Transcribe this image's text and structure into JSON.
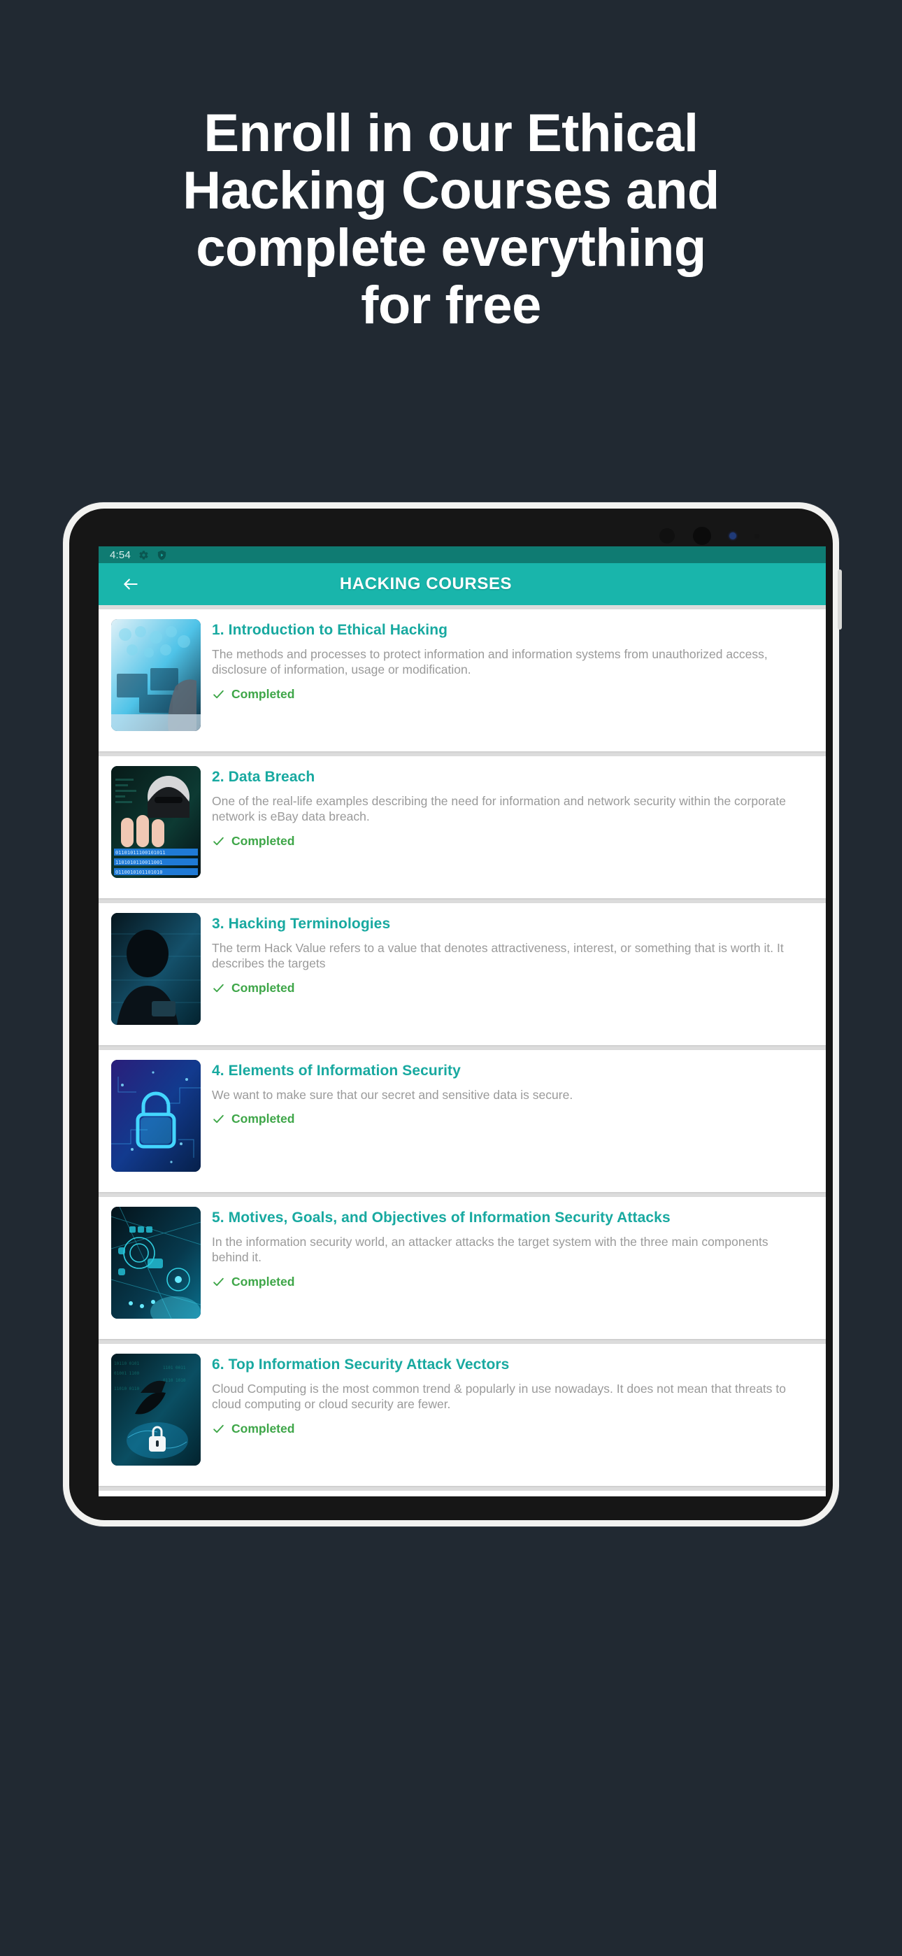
{
  "headline": {
    "lines": [
      "Enroll in our Ethical",
      "Hacking Courses and",
      "complete everything",
      "for free"
    ]
  },
  "colors": {
    "background": "#212932",
    "accent": "#19b5ab",
    "statusbar": "#0f7b72",
    "title_teal": "#18a9a0",
    "completed_green": "#3ea648",
    "desc_grey": "#9a9a9a",
    "list_bg": "#dcdcdc"
  },
  "device": {
    "status_bar": {
      "time": "4:54",
      "icons": [
        "gear-icon",
        "shield-play-icon"
      ]
    },
    "app_bar": {
      "back_icon": "back-arrow-icon",
      "title": "HACKING COURSES"
    }
  },
  "courses": [
    {
      "title": "1. Introduction to Ethical Hacking",
      "description": "The methods and processes to protect information and information systems from unauthorized access,\ndisclosure of information, usage or modification.",
      "status": "Completed",
      "status_icon": "check-icon",
      "thumbnail": "hacker-multiple-monitors-thumbnail"
    },
    {
      "title": "2. Data Breach",
      "description": "One of the real-life examples describing the need for information and network security within the corporate\nnetwork is eBay data breach.",
      "status": "Completed",
      "status_icon": "check-icon",
      "thumbnail": "hooded-hacker-binary-thumbnail"
    },
    {
      "title": "3. Hacking Terminologies",
      "description": "The term Hack Value refers to a value that denotes attractiveness, interest, or something that is worth it. It\ndescribes the targets",
      "status": "Completed",
      "status_icon": "check-icon",
      "thumbnail": "silhouette-hacker-thumbnail"
    },
    {
      "title": "4. Elements of Information Security",
      "description": "We want to make sure that our secret and sensitive data is secure.",
      "status": "Completed",
      "status_icon": "check-icon",
      "thumbnail": "blue-padlock-circuit-thumbnail"
    },
    {
      "title": "5. Motives, Goals, and Objectives of Information Security Attacks",
      "description": "In the information security world, an attacker attacks the target system with the three main components\nbehind it.",
      "status": "Completed",
      "status_icon": "check-icon",
      "thumbnail": "cyber-network-hud-thumbnail"
    },
    {
      "title": "6. Top Information Security Attack Vectors",
      "description": "Cloud Computing is the most common trend & popularly in use nowadays. It does not mean that threats to\ncloud computing or cloud security are fewer.",
      "status": "Completed",
      "status_icon": "check-icon",
      "thumbnail": "hacker-cloud-lock-thumbnail"
    }
  ]
}
